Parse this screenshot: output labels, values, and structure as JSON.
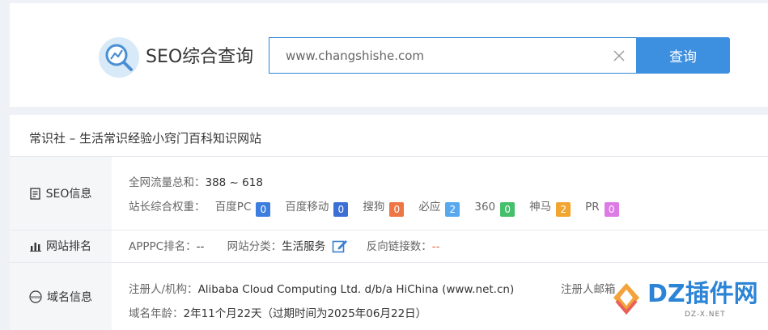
{
  "header": {
    "logo_text": "SEO综合查询",
    "search": {
      "value": "www.changshishe.com",
      "placeholder": ""
    },
    "search_button": "查询"
  },
  "result": {
    "site_title": "常识社 – 生活常识经验小窍门百科知识网站",
    "sections": {
      "seo": {
        "label": "SEO信息",
        "traffic_label": "全网流量总和：",
        "traffic_value": "388 ~ 618",
        "weight_label": "站长综合权重："
      },
      "rank": {
        "label": "网站排名",
        "apppc_label": "APPPC排名：",
        "apppc_value": "--",
        "category_label": "网站分类：",
        "category_value": "生活服务",
        "backlinks_label": "反向链接数：",
        "backlinks_value": "--"
      },
      "domain": {
        "label": "域名信息",
        "registrant_label": "注册人/机构：",
        "registrant_value": "Alibaba Cloud Computing Ltd. d/b/a HiChina (www.net.cn)",
        "email_label": "注册人邮箱",
        "age_label": "域名年龄：",
        "age_value": "2年11个月22天（过期时间为2025年06月22日）"
      }
    },
    "weights": [
      {
        "name": "百度PC",
        "value": "0",
        "color": "#3c7de0"
      },
      {
        "name": "百度移动",
        "value": "0",
        "color": "#3c6fd6"
      },
      {
        "name": "搜狗",
        "value": "0",
        "color": "#ee7645"
      },
      {
        "name": "必应",
        "value": "2",
        "color": "#57a8ee"
      },
      {
        "name": "360",
        "value": "0",
        "color": "#44bf6a"
      },
      {
        "name": "神马",
        "value": "2",
        "color": "#f2a530"
      },
      {
        "name": "PR",
        "value": "0",
        "color": "#dd7ae6"
      }
    ]
  },
  "watermark": {
    "text": "DZ插件网",
    "sub": "DZ-X.NET"
  }
}
